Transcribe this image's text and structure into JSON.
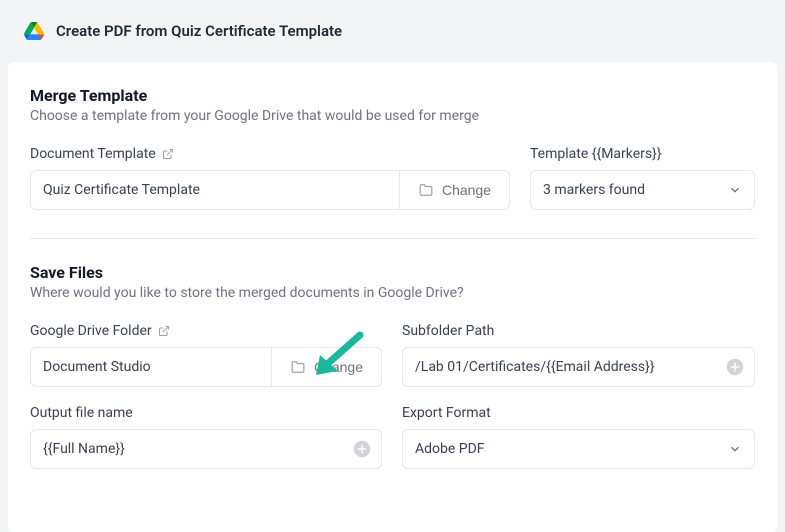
{
  "header": {
    "title": "Create PDF from Quiz Certificate Template"
  },
  "merge_template": {
    "section_title": "Merge Template",
    "section_sub": "Choose a template from your Google Drive that would be used for merge",
    "doc_template_label": "Document Template",
    "doc_template_value": "Quiz Certificate Template",
    "change_label": "Change",
    "markers_label": "Template {{Markers}}",
    "markers_value": "3 markers found"
  },
  "save_files": {
    "section_title": "Save Files",
    "section_sub": "Where would you like to store the merged documents in Google Drive?",
    "folder_label": "Google Drive Folder",
    "folder_value": "Document Studio",
    "change_label": "Change",
    "subfolder_label": "Subfolder Path",
    "subfolder_value": "/Lab 01/Certificates/{{Email Address}}",
    "output_label": "Output file name",
    "output_value": "{{Full Name}}",
    "export_label": "Export Format",
    "export_value": "Adobe PDF"
  }
}
